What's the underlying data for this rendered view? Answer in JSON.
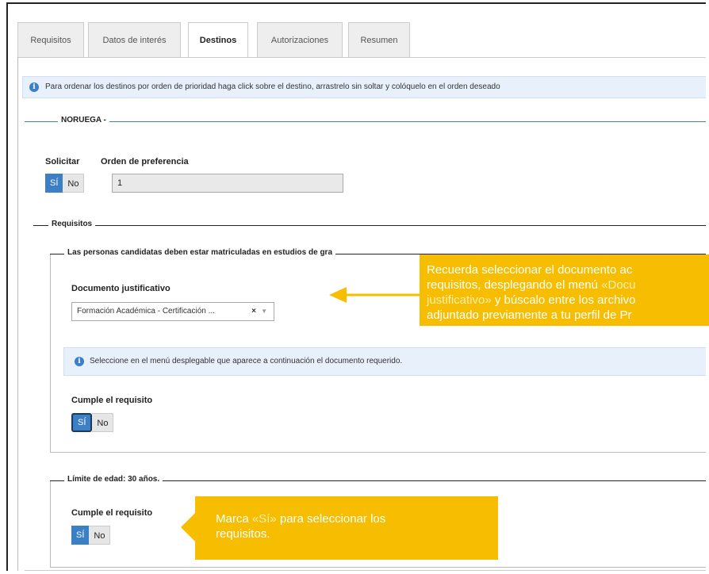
{
  "tabs": [
    {
      "label": "Requisitos",
      "active": false
    },
    {
      "label": "Datos de interés",
      "active": false
    },
    {
      "label": "Destinos",
      "active": true
    },
    {
      "label": "Autorizaciones",
      "active": false
    },
    {
      "label": "Resumen",
      "active": false
    }
  ],
  "info_banner": {
    "icon": "info-icon",
    "text": "Para ordenar los destinos por orden de prioridad haga click sobre el destino, arrastrelo sin soltar y colóquelo en el orden deseado"
  },
  "destination": {
    "name": "NORUEGA -",
    "solicitar_label": "Solicitar",
    "yes": "SÍ",
    "no": "No",
    "orden_label": "Orden de preferencia",
    "orden_value": "1"
  },
  "requisitos": {
    "legend": "Requisitos",
    "req1": {
      "legend": "Las personas candidatas deben estar matriculadas en estudios de gra",
      "doc_label": "Documento justificativo",
      "doc_value": "Formación Académica - Certificación ...",
      "clear_glyph": "×",
      "arrow_glyph": "▼",
      "info_text": "Seleccione en el menú desplegable que aparece a continuación el documento requerido.",
      "cumple_label": "Cumple el requisito",
      "yes": "SÍ",
      "no": "No"
    },
    "req2": {
      "legend": "Límite de edad: 30 años.",
      "cumple_label": "Cumple el requisito",
      "yes": "SÍ",
      "no": "No"
    }
  },
  "callouts": {
    "top": {
      "line1": "Recuerda seleccionar el documento ac",
      "line2a": "requisitos, desplegando el menú ",
      "line2b": "«Docu",
      "line3a": "justificativo»",
      "line3b": " y búscalo entre los archivo",
      "line4": "adjuntado previamente a tu perfil de Pr"
    },
    "bottom": {
      "line1a": "Marca ",
      "line1b": "«Sí»",
      "line1c": " para seleccionar los",
      "line2": "requisitos."
    }
  },
  "colors": {
    "accent": "#3b7fc4",
    "callout": "#f7bd00"
  }
}
